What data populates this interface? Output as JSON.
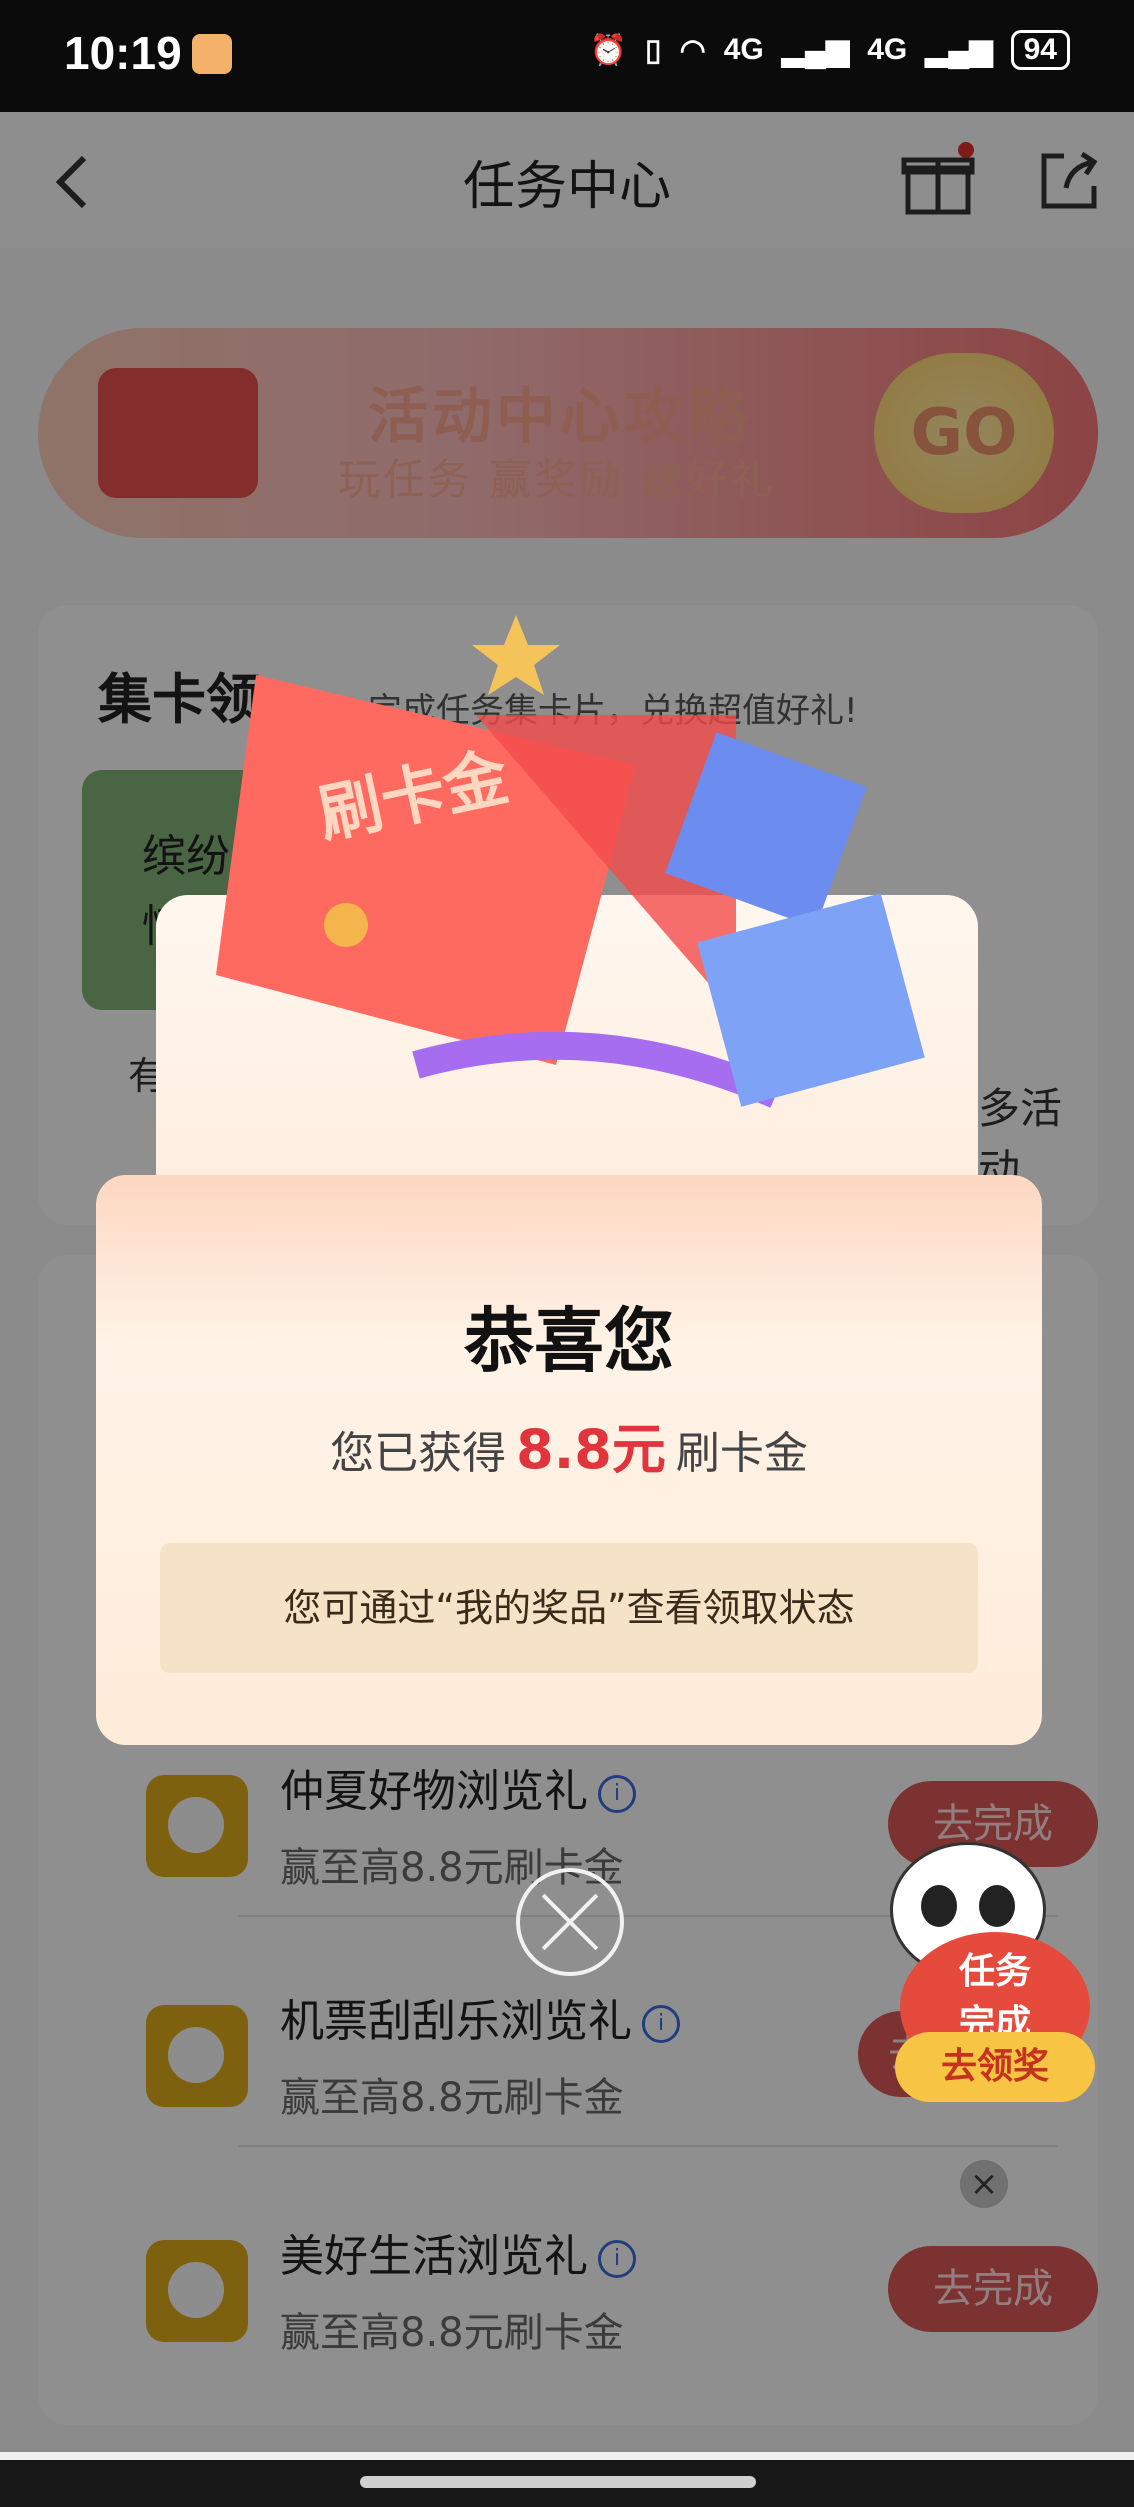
{
  "status_bar": {
    "time": "10:19",
    "network1": "4G",
    "network2": "4G",
    "battery": "94"
  },
  "header": {
    "title": "任务中心"
  },
  "banner": {
    "title": "活动中心攻略",
    "subtitle": "玩任务 赢奖励 送好礼",
    "go": "GO"
  },
  "collect_card": {
    "title": "集卡领",
    "subtitle": "完成任务集卡片，兑换超值好礼!",
    "inner_text_1": "缤纷着",
    "inner_text_2": "惊喜",
    "footer_left": "有",
    "footer_right": "多活动"
  },
  "tasks": [
    {
      "name": "仲夏好物浏览礼",
      "desc": "赢至高8.8元刷卡金",
      "button": "去完成"
    },
    {
      "name": "机票刮刮乐浏览礼",
      "desc": "赢至高8.8元刷卡金",
      "button": "去"
    },
    {
      "name": "美好生活浏览礼",
      "desc": "赢至高8.8元刷卡金",
      "button": "去完成"
    }
  ],
  "modal": {
    "ticket_label": "刷卡金",
    "congrats": "恭喜您",
    "got_prefix": "您已获得",
    "amount": "8.8元",
    "got_suffix": "刷卡金",
    "note": "您可通过“我的奖品”查看领取状态"
  },
  "panda": {
    "badge_text_1": "任务",
    "badge_text_2": "完成",
    "claim": "去领奖"
  },
  "colors": {
    "accent_red": "#e0353d",
    "task_button": "#d85656",
    "task_icon": "#d9a81a"
  }
}
